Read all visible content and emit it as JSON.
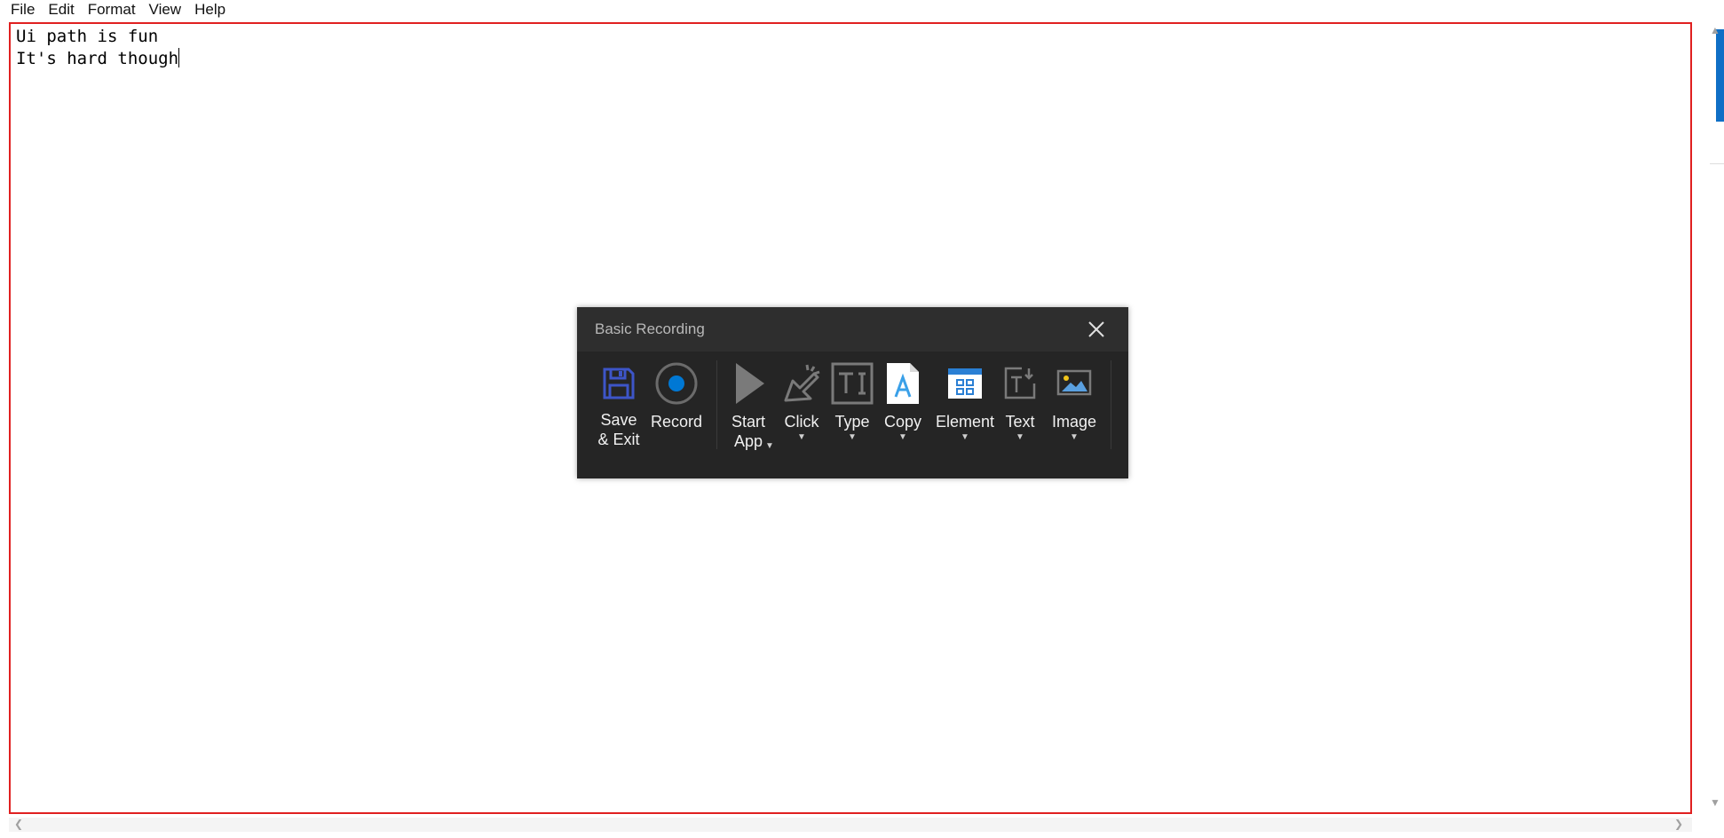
{
  "menu": [
    "File",
    "Edit",
    "Format",
    "View",
    "Help"
  ],
  "editor": {
    "lines": [
      "Ui path is fun",
      "It's hard though"
    ]
  },
  "recorder": {
    "title": "Basic Recording",
    "buttons": [
      {
        "label": "Save\n& Exit",
        "icon": "floppy-disk-icon"
      },
      {
        "label": "Record",
        "icon": "record-icon"
      },
      {
        "label": "Start\nApp",
        "icon": "play-icon"
      },
      {
        "label": "Click",
        "icon": "cursor-click-icon"
      },
      {
        "label": "Type",
        "icon": "text-type-icon"
      },
      {
        "label": "Copy",
        "icon": "copy-document-icon"
      },
      {
        "label": "Element",
        "icon": "element-window-icon"
      },
      {
        "label": "Text",
        "icon": "text-action-icon"
      },
      {
        "label": "Image",
        "icon": "image-icon"
      }
    ]
  },
  "colors": {
    "editor_border": "#e02020",
    "scroll_thumb": "#0f6fc6",
    "recorder_bg": "#252525",
    "record_dot": "#0078d4"
  }
}
